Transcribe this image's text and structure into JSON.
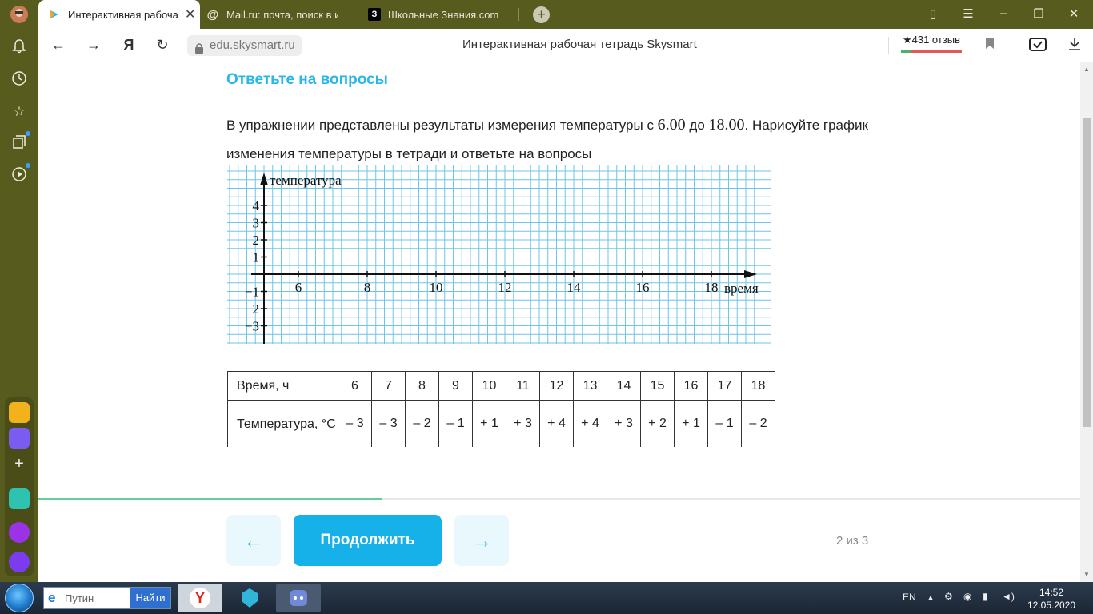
{
  "browser": {
    "tabs": [
      {
        "label": "Интерактивная рабоча",
        "icon": "skysmart-icon"
      },
      {
        "label": "Mail.ru: почта, поиск в ин",
        "icon": "mail-at-icon"
      },
      {
        "label": "Школьные Знания.com - Р",
        "icon": "znanija-icon"
      }
    ],
    "url": "edu.skysmart.ru",
    "page_title": "Интерактивная рабочая тетрадь Skysmart",
    "reviews": "★431 отзыв"
  },
  "page": {
    "section_title": "Ответьте на вопросы",
    "text_part1": "В упражнении представлены результаты измерения температуры с ",
    "time_from": "6.00",
    "text_part2": " до ",
    "time_to": "18.00",
    "text_part3": ". Нарисуйте график изменения температуры в тетради и ответьте на вопросы",
    "continue_label": "Продолжить",
    "prev_arrow": "←",
    "next_arrow": "→",
    "page_counter": "2 из 3",
    "progress": 0.33
  },
  "graph": {
    "y_label": "температура",
    "x_label": "время",
    "x_ticks": [
      "6",
      "8",
      "10",
      "12",
      "14",
      "16",
      "18"
    ],
    "y_ticks": [
      "4",
      "3",
      "2",
      "1",
      "−1",
      "−2",
      "−3"
    ],
    "grid_color": "#6ec6ea"
  },
  "table": {
    "time_header": "Время, ч",
    "temp_header": "Температура, °С",
    "times": [
      "6",
      "7",
      "8",
      "9",
      "10",
      "11",
      "12",
      "13",
      "14",
      "15",
      "16",
      "17",
      "18"
    ],
    "temps": [
      "– 3",
      "– 3",
      "– 2",
      "– 1",
      "+ 1",
      "+ 3",
      "+ 4",
      "+ 4",
      "+ 3",
      "+ 2",
      "+ 1",
      "– 1",
      "– 2"
    ]
  },
  "taskbar": {
    "search_value": "Путин",
    "search_button": "Найти",
    "lang": "EN",
    "time": "14:52",
    "date": "12.05.2020"
  }
}
